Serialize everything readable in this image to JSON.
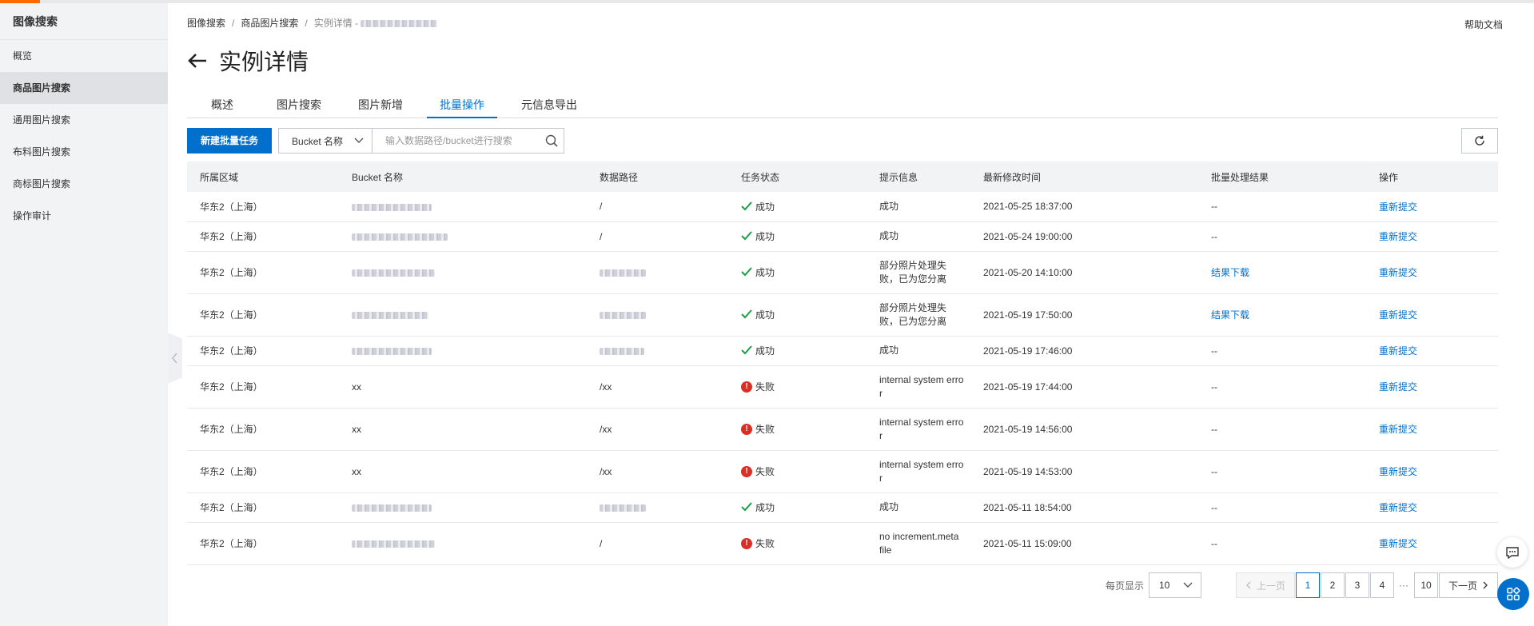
{
  "colors": {
    "accent": "#0070cc",
    "brand": "#ff6a00",
    "success": "#1a9e47",
    "error": "#d93026"
  },
  "sidebar": {
    "title": "图像搜索",
    "items": [
      {
        "label": "概览",
        "active": false
      },
      {
        "label": "商品图片搜索",
        "active": true
      },
      {
        "label": "通用图片搜索",
        "active": false
      },
      {
        "label": "布料图片搜索",
        "active": false
      },
      {
        "label": "商标图片搜索",
        "active": false
      },
      {
        "label": "操作审计",
        "active": false
      }
    ]
  },
  "breadcrumb": {
    "items": [
      "图像搜索",
      "商品图片搜索"
    ],
    "current": "实例详情 -",
    "separator": "/"
  },
  "header": {
    "help": "帮助文档",
    "title": "实例详情"
  },
  "tabs": [
    {
      "label": "概述",
      "active": false
    },
    {
      "label": "图片搜索",
      "active": false
    },
    {
      "label": "图片新增",
      "active": false
    },
    {
      "label": "批量操作",
      "active": true
    },
    {
      "label": "元信息导出",
      "active": false
    }
  ],
  "toolbar": {
    "new_task": "新建批量任务",
    "bucket_select": "Bucket 名称",
    "search_placeholder": "输入数据路径/bucket进行搜索"
  },
  "table": {
    "columns": [
      "所属区域",
      "Bucket 名称",
      "数据路径",
      "任务状态",
      "提示信息",
      "最新修改时间",
      "批量处理结果",
      "操作"
    ],
    "rows": [
      {
        "region": "华东2（上海）",
        "bucket": "",
        "path": "/",
        "status": "成功",
        "ok": true,
        "tip": "成功",
        "time": "2021-05-25 18:37:00",
        "result": "--",
        "action": "重新提交"
      },
      {
        "region": "华东2（上海）",
        "bucket": "",
        "path": "/",
        "status": "成功",
        "ok": true,
        "tip": "成功",
        "time": "2021-05-24 19:00:00",
        "result": "--",
        "action": "重新提交"
      },
      {
        "region": "华东2（上海）",
        "bucket": "",
        "path": "",
        "status": "成功",
        "ok": true,
        "tip": "部分照片处理失败，已为您分离",
        "time": "2021-05-20 14:10:00",
        "result": "结果下载",
        "action": "重新提交"
      },
      {
        "region": "华东2（上海）",
        "bucket": "",
        "path": "",
        "status": "成功",
        "ok": true,
        "tip": "部分照片处理失败，已为您分离",
        "time": "2021-05-19 17:50:00",
        "result": "结果下载",
        "action": "重新提交"
      },
      {
        "region": "华东2（上海）",
        "bucket": "",
        "path": "",
        "status": "成功",
        "ok": true,
        "tip": "成功",
        "time": "2021-05-19 17:46:00",
        "result": "--",
        "action": "重新提交"
      },
      {
        "region": "华东2（上海）",
        "bucket": "xx",
        "path": "/xx",
        "status": "失败",
        "ok": false,
        "tip": "internal system error",
        "time": "2021-05-19 17:44:00",
        "result": "--",
        "action": "重新提交"
      },
      {
        "region": "华东2（上海）",
        "bucket": "xx",
        "path": "/xx",
        "status": "失败",
        "ok": false,
        "tip": "internal system error",
        "time": "2021-05-19 14:56:00",
        "result": "--",
        "action": "重新提交"
      },
      {
        "region": "华东2（上海）",
        "bucket": "xx",
        "path": "/xx",
        "status": "失败",
        "ok": false,
        "tip": "internal system error",
        "time": "2021-05-19 14:53:00",
        "result": "--",
        "action": "重新提交"
      },
      {
        "region": "华东2（上海）",
        "bucket": "",
        "path": "",
        "status": "成功",
        "ok": true,
        "tip": "成功",
        "time": "2021-05-11 18:54:00",
        "result": "--",
        "action": "重新提交"
      },
      {
        "region": "华东2（上海）",
        "bucket": "",
        "path": "/",
        "status": "失败",
        "ok": false,
        "tip": "no increment.meta file",
        "time": "2021-05-11 15:09:00",
        "result": "--",
        "action": "重新提交"
      }
    ]
  },
  "pagination": {
    "per_page_label": "每页显示",
    "per_page": "10",
    "prev": "上一页",
    "next": "下一页",
    "pages": [
      "1",
      "2",
      "3",
      "4"
    ],
    "ellipsis": "···",
    "last": "10",
    "current": "1"
  },
  "icons": [
    "back-arrow-icon",
    "chevron-down-icon",
    "search-icon",
    "refresh-icon",
    "check-icon",
    "error-icon",
    "chat-icon",
    "apps-icon",
    "chevron-left-icon",
    "chevron-right-icon"
  ]
}
